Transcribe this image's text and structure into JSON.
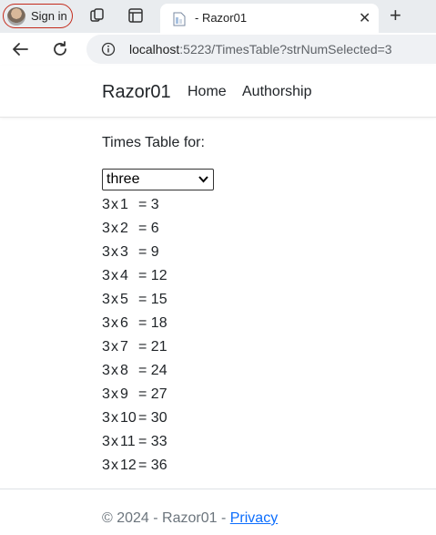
{
  "browser": {
    "profile_label": "Sign in",
    "tab_title": "- Razor01",
    "url_host": "localhost",
    "url_path": ":5223/TimesTable?strNumSelected=3"
  },
  "site": {
    "brand": "Razor01",
    "nav": [
      "Home",
      "Authorship"
    ]
  },
  "main": {
    "heading": "Times Table for:",
    "selected_number": "three",
    "rows": [
      {
        "a": "3",
        "op": "x",
        "b": "1",
        "result": "= 3"
      },
      {
        "a": "3",
        "op": "x",
        "b": "2",
        "result": "= 6"
      },
      {
        "a": "3",
        "op": "x",
        "b": "3",
        "result": "= 9"
      },
      {
        "a": "3",
        "op": "x",
        "b": "4",
        "result": "= 12"
      },
      {
        "a": "3",
        "op": "x",
        "b": "5",
        "result": "= 15"
      },
      {
        "a": "3",
        "op": "x",
        "b": "6",
        "result": "= 18"
      },
      {
        "a": "3",
        "op": "x",
        "b": "7",
        "result": "= 21"
      },
      {
        "a": "3",
        "op": "x",
        "b": "8",
        "result": "= 24"
      },
      {
        "a": "3",
        "op": "x",
        "b": "9",
        "result": "= 27"
      },
      {
        "a": "3",
        "op": "x",
        "b": "10",
        "result": "= 30"
      },
      {
        "a": "3",
        "op": "x",
        "b": "11",
        "result": "= 33"
      },
      {
        "a": "3",
        "op": "x",
        "b": "12",
        "result": "= 36"
      }
    ]
  },
  "footer": {
    "text": "© 2024 - Razor01 - ",
    "link": "Privacy"
  }
}
